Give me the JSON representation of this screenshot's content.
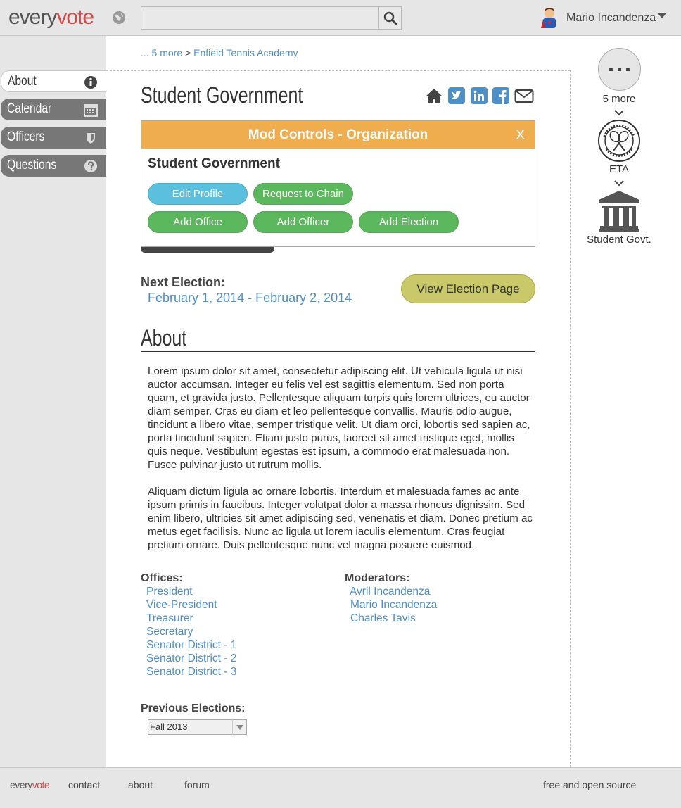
{
  "app": {
    "logo_part1": "every",
    "logo_part2": "vote",
    "brand_color": "#d14b4b"
  },
  "header": {
    "search_placeholder": "",
    "user_name": "Mario Incandenza"
  },
  "sidebar": {
    "items": [
      {
        "label": "About",
        "icon": "info-circle-icon",
        "active": true
      },
      {
        "label": "Calendar",
        "icon": "calendar-icon",
        "active": false
      },
      {
        "label": "Officers",
        "icon": "shield-icon",
        "active": false
      },
      {
        "label": "Questions",
        "icon": "question-circle-icon",
        "active": false
      }
    ]
  },
  "breadcrumb": {
    "more": "... 5 more",
    "separator": ">",
    "current": "Enfield Tennis Academy"
  },
  "page": {
    "title": "Student Government",
    "share_icons": [
      "home-icon",
      "twitter-icon",
      "linkedin-icon",
      "facebook-icon",
      "email-icon"
    ]
  },
  "modal": {
    "title": "Mod Controls - Organization",
    "close": "X",
    "org_name": "Student Government",
    "buttons": {
      "edit_profile": "Edit Profile",
      "request_chain": "Request to Chain",
      "add_office": "Add Office",
      "add_officer": "Add Officer",
      "add_election": "Add Election"
    }
  },
  "election": {
    "next_label": "Next Election:",
    "dates": "February 1, 2014 - February 2, 2014",
    "view_button": "View Election Page"
  },
  "about": {
    "heading": "About",
    "paragraphs": [
      "Lorem ipsum dolor sit amet, consectetur adipiscing elit. Ut vehicula ligula ut nisi auctor accumsan. Integer eu felis vel est sagittis elementum. Sed non porta quam, et gravida justo. Pellentesque aliquam turpis quis lorem ultrices, eu auctor diam semper. Cras eu diam et leo pellentesque convallis. Mauris odio augue, tincidunt a libero vitae, semper tristique velit. Ut diam orci, lobortis sed sapien ac, porta tincidunt sapien. Etiam justo purus, laoreet sit amet tristique eget, mollis quis neque. Vestibulum egestas est ipsum, a commodo erat malesuada non. Fusce pulvinar justo ut rutrum mollis.",
      "Aliquam dictum ligula ac ornare lobortis. Interdum et malesuada fames ac ante ipsum primis in faucibus. Integer volutpat dolor a massa rhoncus dignissim. Sed enim libero, ultricies sit amet adipiscing sed, venenatis et diam. Donec pretium ac metus eget facilisis. Nunc ac ligula ut lorem iaculis elementum. Cras feugiat pretium ornare. Duis pellentesque nunc vel magna posuere euismod."
    ]
  },
  "offices": {
    "label": "Offices:",
    "items": [
      "President",
      "Vice-President",
      "Treasurer",
      "Secretary",
      "Senator District - 1",
      "Senator District - 2",
      "Senator District - 3"
    ]
  },
  "moderators": {
    "label": "Moderators:",
    "items": [
      "Avril Incandenza",
      "Mario Incandenza",
      "Charles Tavis"
    ]
  },
  "previous_elections": {
    "label": "Previous Elections:",
    "selected": "Fall 2013"
  },
  "chain": {
    "more_label": "5 more",
    "eta_label": "ETA",
    "student_govt_label": "Student Govt."
  },
  "footer": {
    "logo_part1": "every",
    "logo_part2": "vote",
    "links": [
      "contact",
      "about",
      "forum"
    ],
    "right_text": "free and open source"
  }
}
